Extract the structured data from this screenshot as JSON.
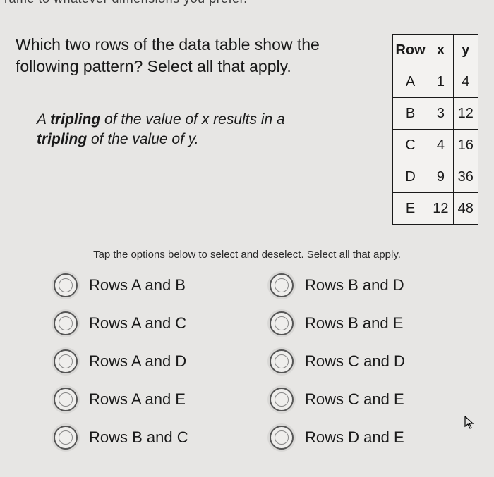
{
  "cut_text": "rame to whatever dimensions you prefer.",
  "question": "Which two rows of the data table show the following pattern? Select all that apply.",
  "pattern_html_parts": {
    "p1": "A ",
    "b1": "tripling",
    "p2": " of the value of x results in a ",
    "b2": "tripling",
    "p3": " of the value of y."
  },
  "table": {
    "headers": [
      "Row",
      "x",
      "y"
    ],
    "rows": [
      [
        "A",
        "1",
        "4"
      ],
      [
        "B",
        "3",
        "12"
      ],
      [
        "C",
        "4",
        "16"
      ],
      [
        "D",
        "9",
        "36"
      ],
      [
        "E",
        "12",
        "48"
      ]
    ]
  },
  "hint": "Tap the options below to select and deselect. Select all that apply.",
  "options": [
    "Rows A and B",
    "Rows A and C",
    "Rows A and D",
    "Rows A and E",
    "Rows B and C",
    "Rows B and D",
    "Rows B and E",
    "Rows C and D",
    "Rows C and E",
    "Rows D and E"
  ],
  "chart_data": {
    "type": "table",
    "columns": [
      "Row",
      "x",
      "y"
    ],
    "rows": [
      {
        "Row": "A",
        "x": 1,
        "y": 4
      },
      {
        "Row": "B",
        "x": 3,
        "y": 12
      },
      {
        "Row": "C",
        "x": 4,
        "y": 16
      },
      {
        "Row": "D",
        "x": 9,
        "y": 36
      },
      {
        "Row": "E",
        "x": 12,
        "y": 48
      }
    ]
  }
}
